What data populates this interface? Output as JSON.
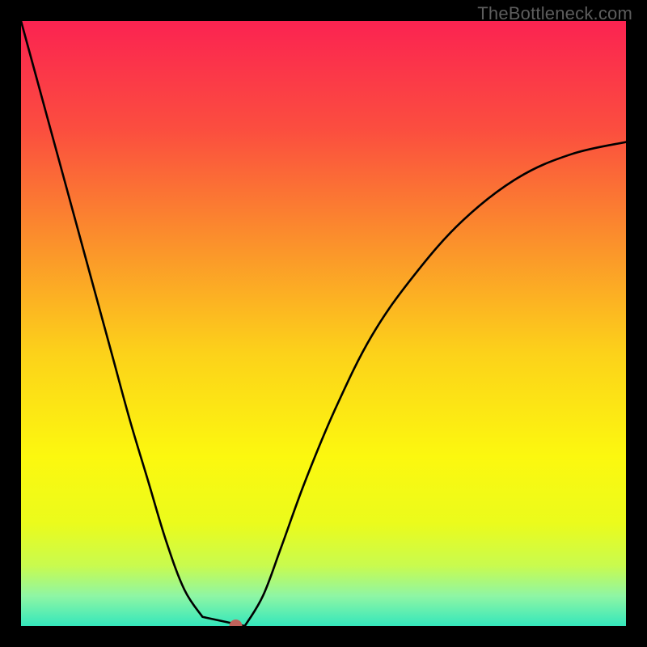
{
  "watermark": "TheBottleneck.com",
  "chart_data": {
    "type": "line",
    "title": "",
    "xlabel": "",
    "ylabel": "",
    "xlim": [
      0,
      1
    ],
    "ylim": [
      0,
      1
    ],
    "x": [
      0.0,
      0.03,
      0.06,
      0.09,
      0.12,
      0.15,
      0.18,
      0.21,
      0.24,
      0.27,
      0.3,
      0.32,
      0.34,
      0.355,
      0.37,
      0.4,
      0.43,
      0.47,
      0.52,
      0.58,
      0.65,
      0.73,
      0.82,
      0.91,
      1.0
    ],
    "y": [
      1.0,
      0.89,
      0.78,
      0.67,
      0.56,
      0.45,
      0.34,
      0.24,
      0.14,
      0.06,
      0.015,
      0.0,
      0.0,
      0.0,
      0.0,
      0.05,
      0.13,
      0.24,
      0.36,
      0.48,
      0.58,
      0.67,
      0.74,
      0.78,
      0.8
    ],
    "marker": {
      "x": 0.355,
      "y": 0.0,
      "color": "#c0625b",
      "radius": 8
    },
    "flat_bottom": {
      "x0": 0.3,
      "x1": 0.37,
      "y": 0.0
    },
    "gradient_stops": [
      {
        "pos": 0.0,
        "color": "#fb2351"
      },
      {
        "pos": 0.18,
        "color": "#fb4e3f"
      },
      {
        "pos": 0.35,
        "color": "#fb8b2d"
      },
      {
        "pos": 0.55,
        "color": "#fcd21a"
      },
      {
        "pos": 0.72,
        "color": "#fcf80f"
      },
      {
        "pos": 0.83,
        "color": "#ebfb1c"
      },
      {
        "pos": 0.9,
        "color": "#c9fb4e"
      },
      {
        "pos": 0.95,
        "color": "#8ff6a4"
      },
      {
        "pos": 1.0,
        "color": "#34e7bc"
      }
    ]
  }
}
